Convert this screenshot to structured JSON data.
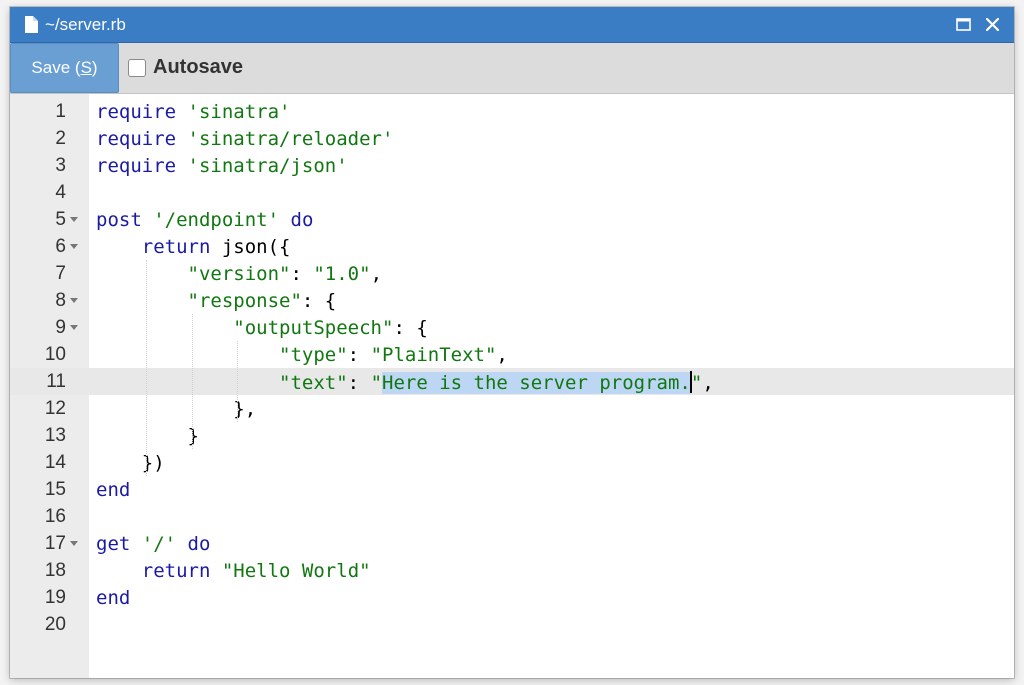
{
  "window": {
    "title": "~/server.rb"
  },
  "toolbar": {
    "save_label": "Save (",
    "save_shortcut": "S",
    "save_close": ")",
    "autosave_label": "Autosave",
    "autosave_checked": false
  },
  "editor": {
    "active_line": 11,
    "lines": [
      {
        "n": "1",
        "fold": false,
        "parts": [
          [
            "kw-plain",
            "require "
          ],
          [
            "str",
            "'sinatra'"
          ]
        ]
      },
      {
        "n": "2",
        "fold": false,
        "parts": [
          [
            "kw-plain",
            "require "
          ],
          [
            "str",
            "'sinatra/reloader'"
          ]
        ]
      },
      {
        "n": "3",
        "fold": false,
        "parts": [
          [
            "kw-plain",
            "require "
          ],
          [
            "str",
            "'sinatra/json'"
          ]
        ]
      },
      {
        "n": "4",
        "fold": false,
        "parts": []
      },
      {
        "n": "5",
        "fold": true,
        "parts": [
          [
            "kw-plain",
            "post "
          ],
          [
            "str",
            "'/endpoint'"
          ],
          [
            "plain",
            " "
          ],
          [
            "kw",
            "do"
          ]
        ]
      },
      {
        "n": "6",
        "fold": true,
        "parts": [
          [
            "plain",
            "    "
          ],
          [
            "kw",
            "return"
          ],
          [
            "plain",
            " json({"
          ]
        ]
      },
      {
        "n": "7",
        "fold": false,
        "parts": [
          [
            "plain",
            "        "
          ],
          [
            "str",
            "\"version\""
          ],
          [
            "plain",
            ": "
          ],
          [
            "str",
            "\"1.0\""
          ],
          [
            "plain",
            ","
          ]
        ]
      },
      {
        "n": "8",
        "fold": true,
        "parts": [
          [
            "plain",
            "        "
          ],
          [
            "str",
            "\"response\""
          ],
          [
            "plain",
            ": {"
          ]
        ]
      },
      {
        "n": "9",
        "fold": true,
        "parts": [
          [
            "plain",
            "            "
          ],
          [
            "str",
            "\"outputSpeech\""
          ],
          [
            "plain",
            ": {"
          ]
        ]
      },
      {
        "n": "10",
        "fold": false,
        "parts": [
          [
            "plain",
            "                "
          ],
          [
            "str",
            "\"type\""
          ],
          [
            "plain",
            ": "
          ],
          [
            "str",
            "\"PlainText\""
          ],
          [
            "plain",
            ","
          ]
        ]
      },
      {
        "n": "11",
        "fold": false,
        "parts": [
          [
            "plain",
            "                "
          ],
          [
            "str",
            "\"text\""
          ],
          [
            "plain",
            ": "
          ],
          [
            "str",
            "\""
          ],
          [
            "sel",
            "Here is the server program."
          ],
          [
            "caret",
            ""
          ],
          [
            "str",
            "\""
          ],
          [
            "plain",
            ","
          ]
        ]
      },
      {
        "n": "12",
        "fold": false,
        "parts": [
          [
            "plain",
            "            },"
          ]
        ]
      },
      {
        "n": "13",
        "fold": false,
        "parts": [
          [
            "plain",
            "        }"
          ]
        ]
      },
      {
        "n": "14",
        "fold": false,
        "parts": [
          [
            "plain",
            "    })"
          ]
        ]
      },
      {
        "n": "15",
        "fold": false,
        "parts": [
          [
            "kw",
            "end"
          ]
        ]
      },
      {
        "n": "16",
        "fold": false,
        "parts": []
      },
      {
        "n": "17",
        "fold": true,
        "parts": [
          [
            "kw-plain",
            "get "
          ],
          [
            "str",
            "'/'"
          ],
          [
            "plain",
            " "
          ],
          [
            "kw",
            "do"
          ]
        ]
      },
      {
        "n": "18",
        "fold": false,
        "parts": [
          [
            "plain",
            "    "
          ],
          [
            "kw",
            "return"
          ],
          [
            "plain",
            " "
          ],
          [
            "str",
            "\"Hello World\""
          ]
        ]
      },
      {
        "n": "19",
        "fold": false,
        "parts": [
          [
            "kw",
            "end"
          ]
        ]
      },
      {
        "n": "20",
        "fold": false,
        "parts": []
      }
    ]
  },
  "colors": {
    "titlebar": "#3b7dc4",
    "save_button": "#6a9fd3",
    "keyword": "#1a1aa6",
    "string": "#117711",
    "selection": "#bcd6f4"
  },
  "icons": {
    "document": "document-icon",
    "maximize": "maximize-icon",
    "close": "close-icon",
    "fold": "fold-arrow-icon"
  }
}
